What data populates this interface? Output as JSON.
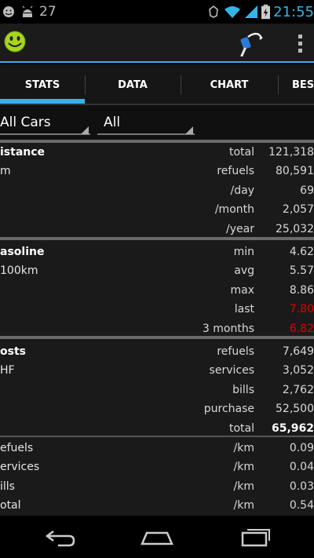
{
  "status_bar": {
    "notification_number": "27",
    "clock": "21:55",
    "icons": [
      "smiley-notification-icon",
      "android-debug-icon",
      "sync-icon",
      "wifi-icon",
      "signal-icon",
      "battery-icon"
    ]
  },
  "action_bar": {
    "app_icon": "smiley-app-icon",
    "action_icon": "fuel-pump-icon",
    "overflow_icon": "overflow-menu-icon"
  },
  "tabs": [
    {
      "label": "STATS",
      "selected": true
    },
    {
      "label": "DATA",
      "selected": false
    },
    {
      "label": "CHART",
      "selected": false
    },
    {
      "label": "BEST",
      "selected": false
    }
  ],
  "filters": {
    "car": "All Cars",
    "period": "All"
  },
  "sections": {
    "distance": {
      "rows": [
        {
          "label": "istance",
          "metric": "total",
          "value": "121,318"
        },
        {
          "label": "m",
          "metric": "refuels",
          "value": "80,591"
        },
        {
          "label": "",
          "metric": "/day",
          "value": "69"
        },
        {
          "label": "",
          "metric": "/month",
          "value": "2,057"
        },
        {
          "label": "",
          "metric": "/year",
          "value": "25,032"
        }
      ]
    },
    "gasoline": {
      "rows": [
        {
          "label": "asoline",
          "metric": "min",
          "value": "4.62"
        },
        {
          "label": "100km",
          "metric": "avg",
          "value": "5.57"
        },
        {
          "label": "",
          "metric": "max",
          "value": "8.86"
        },
        {
          "label": "",
          "metric": "last",
          "value": "7.80"
        },
        {
          "label": "",
          "metric": "3 months",
          "value": "6.82"
        }
      ]
    },
    "costs": {
      "rows": [
        {
          "label": "osts",
          "metric": "refuels",
          "value": "7,649"
        },
        {
          "label": "HF",
          "metric": "services",
          "value": "3,052"
        },
        {
          "label": "",
          "metric": "bills",
          "value": "2,762"
        },
        {
          "label": "",
          "metric": "purchase",
          "value": "52,500"
        },
        {
          "label": "",
          "metric": "total",
          "value": "65,962"
        }
      ]
    },
    "per_km": {
      "rows": [
        {
          "label": "efuels",
          "metric": "/km",
          "value": "0.09"
        },
        {
          "label": "ervices",
          "metric": "/km",
          "value": "0.04"
        },
        {
          "label": "ills",
          "metric": "/km",
          "value": "0.03"
        },
        {
          "label": "otal",
          "metric": "/km",
          "value": "0.54"
        }
      ]
    }
  },
  "colors": {
    "accent": "#33b5e5",
    "highlight_red": "#e00000",
    "background": "#1a1a1a"
  },
  "nav_bar": {
    "icons": [
      "back-icon",
      "home-icon",
      "recents-icon"
    ]
  }
}
